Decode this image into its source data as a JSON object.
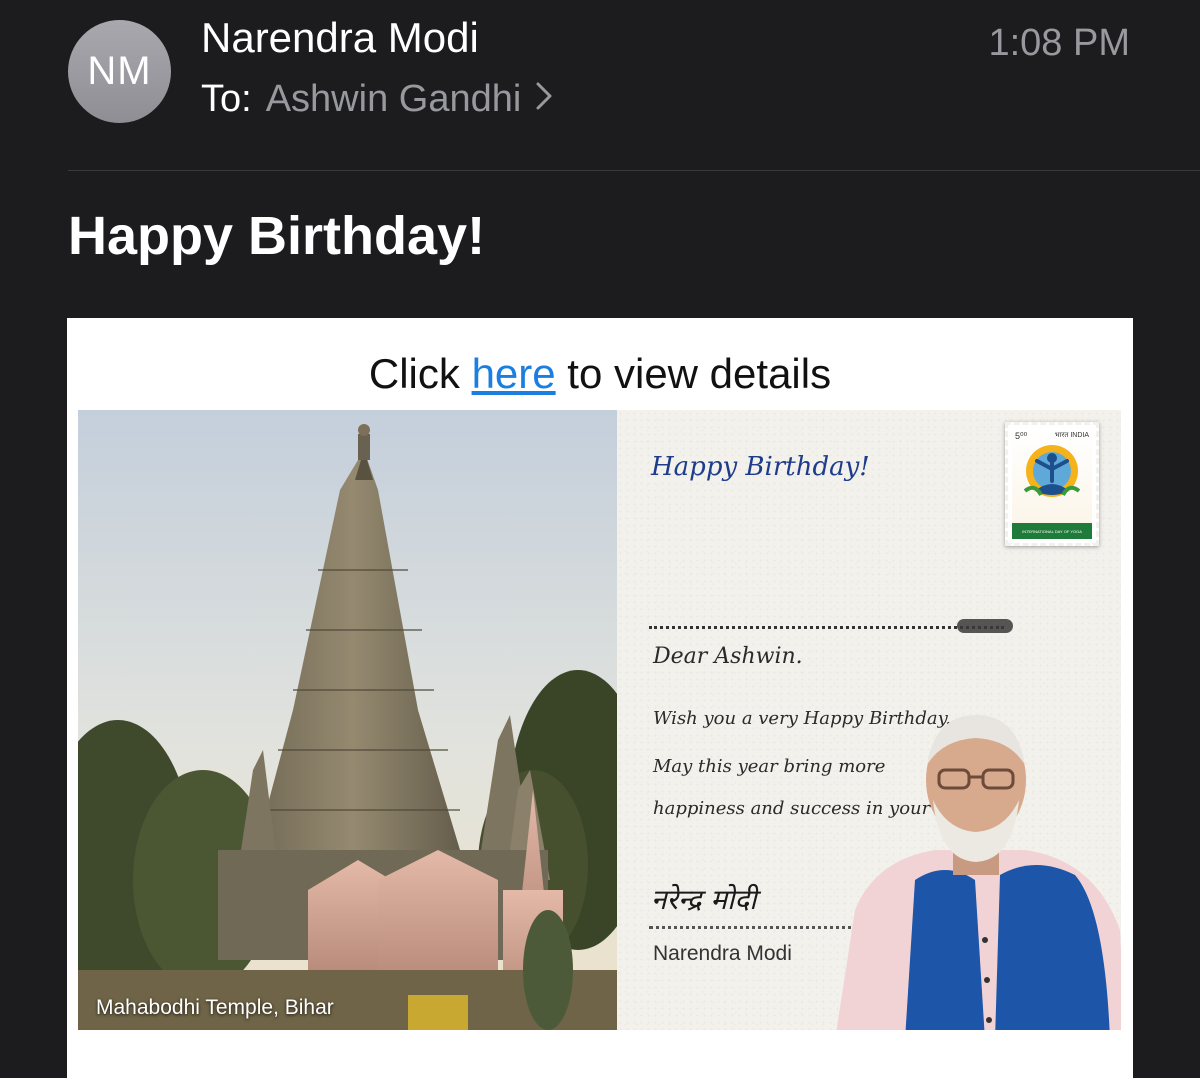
{
  "header": {
    "avatar_initials": "NM",
    "sender_name": "Narendra Modi",
    "to_label": "To:",
    "recipient_name": "Ashwin Gandhi",
    "time": "1:08 PM"
  },
  "subject": "Happy Birthday!",
  "body": {
    "click_prefix": "Click",
    "link_text": "here",
    "click_suffix": "to view details",
    "photo_caption": "Mahabodhi Temple, Bihar",
    "card": {
      "greeting": "Happy Birthday!",
      "salutation": "Dear Ashwin.",
      "message_lines": [
        "Wish you a very Happy Birthday.",
        "May this year bring more",
        "happiness and success in your life!"
      ],
      "signature_handwritten": "नरेन्द्र मोदी",
      "signer_name": "Narendra Modi",
      "stamp": {
        "value": "5⁰⁰",
        "country": "भारत INDIA",
        "band_text": "INTERNATIONAL DAY OF YOGA"
      }
    }
  },
  "colors": {
    "background": "#1c1c1e",
    "secondary_text": "#98989f",
    "link": "#1a7fe0",
    "card_greeting_ink": "#1e3c8c",
    "vest_blue": "#1d56a8"
  },
  "icons": {
    "recipient_chevron": "chevron-right-icon"
  }
}
